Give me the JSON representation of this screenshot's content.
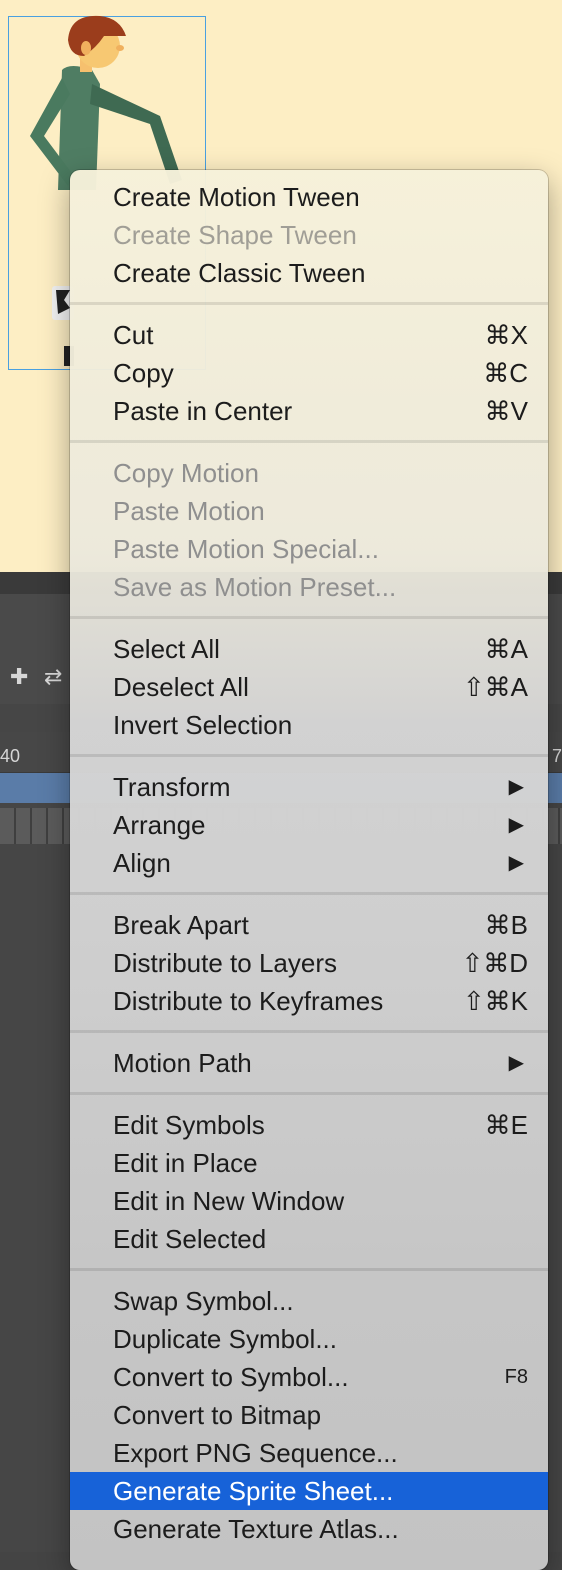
{
  "ruler": {
    "left_number": "40",
    "right_number": "7"
  },
  "menu": {
    "groups": [
      [
        {
          "label": "Create Motion Tween",
          "shortcut": "",
          "enabled": true
        },
        {
          "label": "Create Shape Tween",
          "shortcut": "",
          "enabled": false
        },
        {
          "label": "Create Classic Tween",
          "shortcut": "",
          "enabled": true
        }
      ],
      [
        {
          "label": "Cut",
          "shortcut": "⌘X",
          "enabled": true
        },
        {
          "label": "Copy",
          "shortcut": "⌘C",
          "enabled": true
        },
        {
          "label": "Paste in Center",
          "shortcut": "⌘V",
          "enabled": true
        }
      ],
      [
        {
          "label": "Copy Motion",
          "shortcut": "",
          "enabled": false
        },
        {
          "label": "Paste Motion",
          "shortcut": "",
          "enabled": false
        },
        {
          "label": "Paste Motion Special...",
          "shortcut": "",
          "enabled": false
        },
        {
          "label": "Save as Motion Preset...",
          "shortcut": "",
          "enabled": false
        }
      ],
      [
        {
          "label": "Select All",
          "shortcut": "⌘A",
          "enabled": true
        },
        {
          "label": "Deselect All",
          "shortcut": "⇧⌘A",
          "enabled": true
        },
        {
          "label": "Invert Selection",
          "shortcut": "",
          "enabled": true
        }
      ],
      [
        {
          "label": "Transform",
          "submenu": true,
          "enabled": true
        },
        {
          "label": "Arrange",
          "submenu": true,
          "enabled": true
        },
        {
          "label": "Align",
          "submenu": true,
          "enabled": true
        }
      ],
      [
        {
          "label": "Break Apart",
          "shortcut": "⌘B",
          "enabled": true
        },
        {
          "label": "Distribute to Layers",
          "shortcut": "⇧⌘D",
          "enabled": true
        },
        {
          "label": "Distribute to Keyframes",
          "shortcut": "⇧⌘K",
          "enabled": true
        }
      ],
      [
        {
          "label": "Motion Path",
          "submenu": true,
          "enabled": true
        }
      ],
      [
        {
          "label": "Edit Symbols",
          "shortcut": "⌘E",
          "enabled": true
        },
        {
          "label": "Edit in Place",
          "shortcut": "",
          "enabled": true
        },
        {
          "label": "Edit in New Window",
          "shortcut": "",
          "enabled": true
        },
        {
          "label": "Edit Selected",
          "shortcut": "",
          "enabled": true
        }
      ],
      [
        {
          "label": "Swap Symbol...",
          "shortcut": "",
          "enabled": true
        },
        {
          "label": "Duplicate Symbol...",
          "shortcut": "",
          "enabled": true
        },
        {
          "label": "Convert to Symbol...",
          "shortcut": "F8",
          "enabled": true
        },
        {
          "label": "Convert to Bitmap",
          "shortcut": "",
          "enabled": true
        },
        {
          "label": "Export PNG Sequence...",
          "shortcut": "",
          "enabled": true
        },
        {
          "label": "Generate Sprite Sheet...",
          "shortcut": "",
          "enabled": true,
          "highlighted": true
        },
        {
          "label": "Generate Texture Atlas...",
          "shortcut": "",
          "enabled": true
        }
      ]
    ]
  }
}
